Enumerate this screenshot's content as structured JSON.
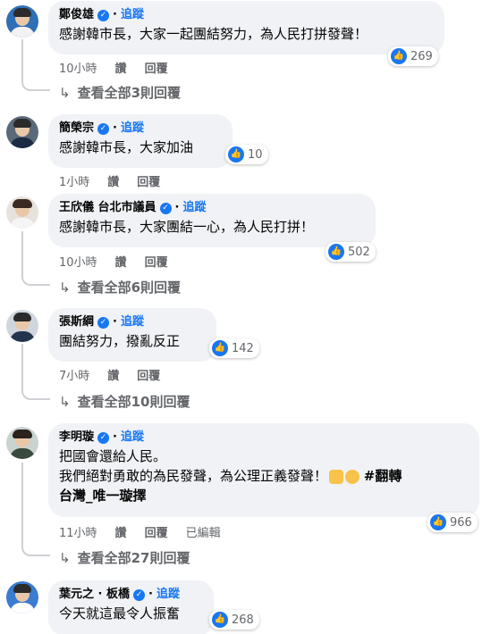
{
  "follow_label": "追蹤",
  "like_label": "讚",
  "reply_label": "回覆",
  "comments": [
    {
      "name": "鄭俊雄",
      "text": "感謝韓市長，大家一起團結努力，為人民打拼發聲！",
      "reactions": "269",
      "time": "10小時",
      "view_replies": "查看全部3則回覆"
    },
    {
      "name": "簡榮宗",
      "text": "感謝韓市長，大家加油",
      "reactions": "10",
      "time": "1小時"
    },
    {
      "name": "王欣儀 台北市議員",
      "text": "感謝韓市長，大家團結一心，為人民打拼！",
      "reactions": "502",
      "time": "10小時",
      "view_replies": "查看全部6則回覆"
    },
    {
      "name": "張斯綱",
      "text": "團結努力，撥亂反正",
      "reactions": "142",
      "time": "7小時",
      "view_replies": "查看全部10則回覆"
    },
    {
      "name": "李明璇",
      "text_line1": "把國會還給人民。",
      "text_line2": "我們絕對勇敢的為民發聲，為公理正義發聲！",
      "hashtag1": "#翻轉",
      "hashtag2": "台灣_唯一璇擇",
      "reactions": "966",
      "time": "11小時",
      "edited": "已編輯",
      "view_replies": "查看全部27則回覆"
    },
    {
      "name": "葉元之 · 板橋",
      "text": "今天就這最令人振奮",
      "reactions": "268"
    }
  ]
}
